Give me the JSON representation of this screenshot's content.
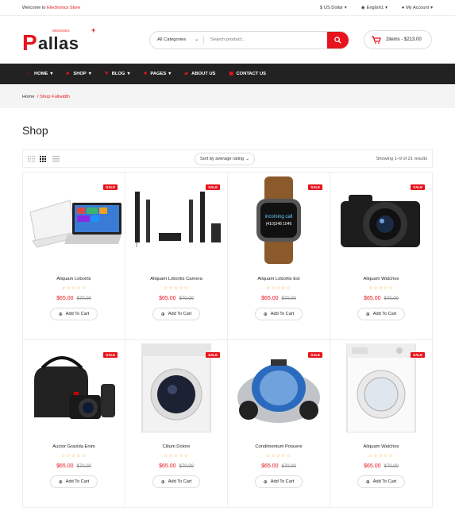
{
  "topbar": {
    "welcome_prefix": "Welcome to",
    "welcome_brand": "Electronics Store",
    "currency": "US Dollar",
    "language": "English1",
    "account": "My Account"
  },
  "header": {
    "logo_initial": "P",
    "logo_rest": "allas",
    "logo_tagline": "electronics",
    "search_category": "All Categories",
    "search_placeholder": "Search product...",
    "cart_summary": "2items - $213.00"
  },
  "nav": {
    "items": [
      {
        "label": "HOME",
        "caret": true
      },
      {
        "label": "SHOP",
        "caret": true
      },
      {
        "label": "BLOG",
        "caret": true
      },
      {
        "label": "PAGES",
        "caret": true
      },
      {
        "label": "ABOUT US",
        "caret": false
      },
      {
        "label": "CONTACT US",
        "caret": false
      }
    ]
  },
  "breadcrumb": {
    "home": "Home",
    "separator": "/",
    "current": "Shop Fullwidth"
  },
  "page": {
    "title": "Shop"
  },
  "toolbar": {
    "sort": "Sort by average rating",
    "showing": "Showing 1–9 of 21 results"
  },
  "products": [
    {
      "name": "Aliquam Lobortis",
      "price": "$65.00",
      "old_price": "$70.00",
      "badge": "SALE",
      "button": "Add To Cart",
      "icon": "laptop-image"
    },
    {
      "name": "Aliquam Lobortis Camera",
      "price": "$65.00",
      "old_price": "$70.00",
      "badge": "SALE",
      "button": "Add To Cart",
      "icon": "speaker-system-image"
    },
    {
      "name": "Aliquam Lobortis Est",
      "price": "$65.00",
      "old_price": "$70.00",
      "badge": "SALE",
      "button": "Add To Cart",
      "icon": "smartwatch-image"
    },
    {
      "name": "Aliquam Watches",
      "price": "$65.00",
      "old_price": "$70.00",
      "badge": "SALE",
      "button": "Add To Cart",
      "icon": "camera-image"
    },
    {
      "name": "Auctor Gravida Enim",
      "price": "$65.00",
      "old_price": "$70.00",
      "badge": "SALE",
      "button": "Add To Cart",
      "icon": "camera-bag-image"
    },
    {
      "name": "Cillum Dolore",
      "price": "$65.00",
      "old_price": "$70.00",
      "badge": "SALE",
      "button": "Add To Cart",
      "icon": "washer-image"
    },
    {
      "name": "Condimentum Posuere",
      "price": "$65.00",
      "old_price": "$70.00",
      "badge": "SALE",
      "button": "Add To Cart",
      "icon": "vacuum-image"
    },
    {
      "name": "Aliquam Watches",
      "price": "$65.00",
      "old_price": "$70.00",
      "badge": "SALE",
      "button": "Add To Cart",
      "icon": "washing-machine-image"
    }
  ],
  "colors": {
    "accent": "#e8141d",
    "nav_bg": "#222222",
    "star": "#f5a623"
  }
}
